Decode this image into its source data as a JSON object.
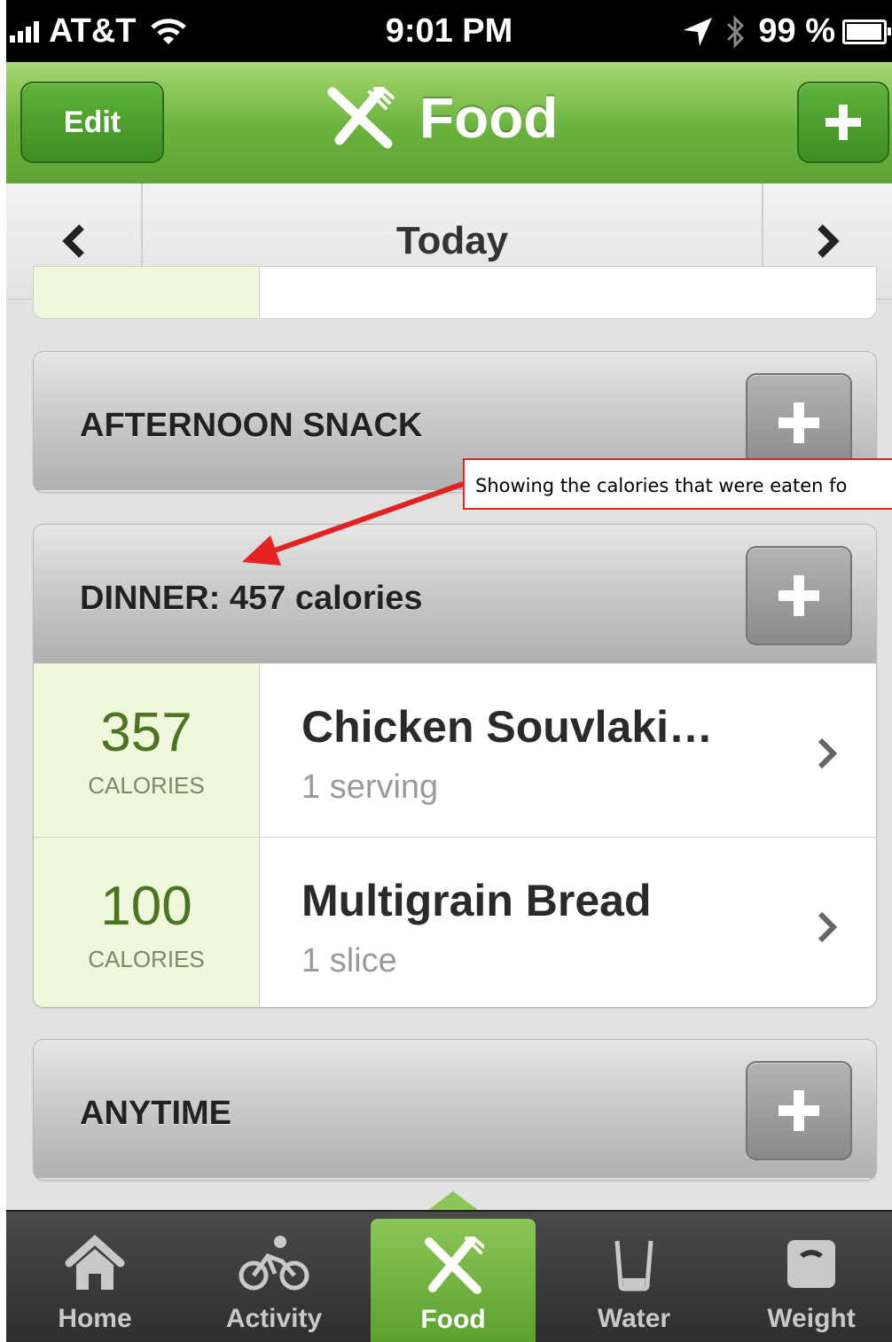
{
  "status_bar": {
    "carrier": "AT&T",
    "time": "9:01 PM",
    "battery": "99 %"
  },
  "nav": {
    "edit_label": "Edit",
    "title": "Food",
    "add_icon": "plus-icon",
    "title_icon": "fork-knife-icon"
  },
  "date_bar": {
    "label": "Today"
  },
  "sections": {
    "snack": {
      "title": "AFTERNOON SNACK"
    },
    "dinner": {
      "title": "DINNER: 457 calories",
      "items": [
        {
          "calories": "357",
          "unit": "CALORIES",
          "name": "Chicken Souvlaki…",
          "serving": "1 serving"
        },
        {
          "calories": "100",
          "unit": "CALORIES",
          "name": "Multigrain Bread",
          "serving": "1 slice"
        }
      ]
    },
    "anytime": {
      "title": "ANYTIME"
    }
  },
  "annotation": {
    "text": "Showing the calories that were eaten fo",
    "color": "#e52222"
  },
  "tabs": [
    {
      "label": "Home",
      "icon": "home-icon"
    },
    {
      "label": "Activity",
      "icon": "cyclist-icon"
    },
    {
      "label": "Food",
      "icon": "fork-knife-icon",
      "active": true
    },
    {
      "label": "Water",
      "icon": "cup-icon"
    },
    {
      "label": "Weight",
      "icon": "scale-icon"
    }
  ],
  "colors": {
    "brand_green": "#6ab23d",
    "calorie_green": "#4c7521",
    "tab_bg": "#333333"
  }
}
